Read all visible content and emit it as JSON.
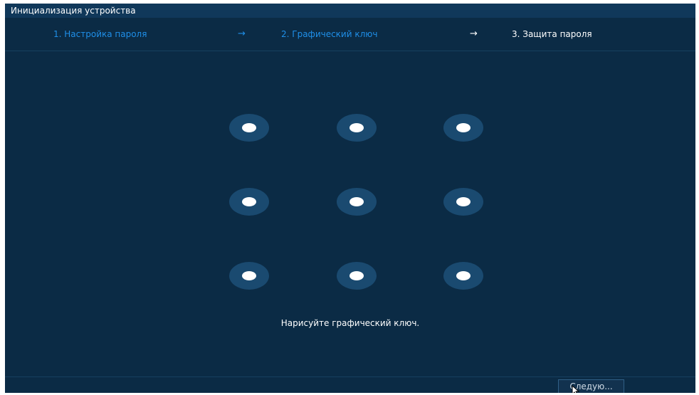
{
  "window": {
    "title": "Инициализация устройства"
  },
  "steps": [
    {
      "label": "1.  Настройка пароля",
      "state": "done"
    },
    {
      "label": "2.  Графический ключ",
      "state": "done"
    },
    {
      "label": "3.  Защита пароля",
      "state": "current"
    }
  ],
  "step_arrow": "→",
  "pattern": {
    "rows": 3,
    "cols": 3,
    "hint": "Нарисуйте графический ключ."
  },
  "footer": {
    "next_label": "Следую..."
  },
  "colors": {
    "background": "#0b2b45",
    "title_bar": "#10385a",
    "accent": "#1f8fe8",
    "dot_ring": "#1a4a70",
    "dot_core": "#ffffff"
  }
}
